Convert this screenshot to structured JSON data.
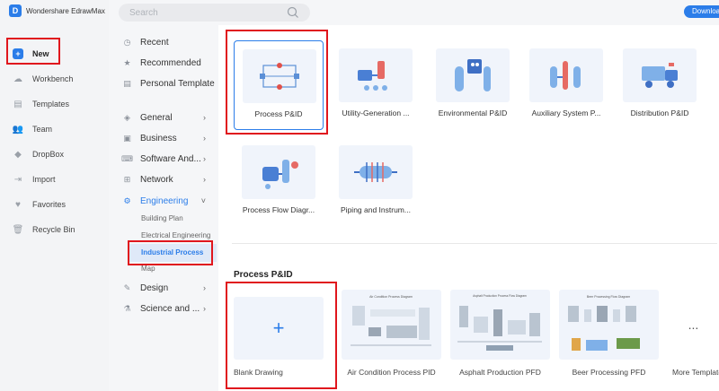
{
  "app": {
    "title": "Wondershare EdrawMax"
  },
  "nav": {
    "items": [
      {
        "label": "New",
        "icon": "plus-icon"
      },
      {
        "label": "Workbench",
        "icon": "cloud-icon"
      },
      {
        "label": "Templates",
        "icon": "templates-icon"
      },
      {
        "label": "Team",
        "icon": "team-icon"
      },
      {
        "label": "DropBox",
        "icon": "dropbox-icon"
      },
      {
        "label": "Import",
        "icon": "import-icon"
      },
      {
        "label": "Favorites",
        "icon": "heart-icon"
      },
      {
        "label": "Recycle Bin",
        "icon": "trash-icon"
      }
    ]
  },
  "search": {
    "placeholder": "Search"
  },
  "download": {
    "label": "Download"
  },
  "categories": {
    "items": [
      {
        "label": "Recent"
      },
      {
        "label": "Recommended"
      },
      {
        "label": "Personal Template"
      },
      {
        "label": "General"
      },
      {
        "label": "Business"
      },
      {
        "label": "Software And..."
      },
      {
        "label": "Network"
      },
      {
        "label": "Engineering"
      },
      {
        "label": "Design"
      },
      {
        "label": "Science and ..."
      }
    ],
    "engineering_sub": [
      {
        "label": "Building Plan"
      },
      {
        "label": "Electrical Engineering"
      },
      {
        "label": "Industrial Process"
      },
      {
        "label": "Map"
      }
    ]
  },
  "templates": [
    {
      "label": "Process P&ID"
    },
    {
      "label": "Utility-Generation ..."
    },
    {
      "label": "Environmental P&ID"
    },
    {
      "label": "Auxiliary System P..."
    },
    {
      "label": "Distribution P&ID"
    },
    {
      "label": "Process Flow Diagr..."
    },
    {
      "label": "Piping and Instrum..."
    }
  ],
  "section": {
    "title": "Process P&ID",
    "blank": {
      "label": "Blank Drawing",
      "plus": "+"
    },
    "docs": [
      {
        "label": "Air Condition Process PID",
        "thumb_title": "Air Condition Process Diagram"
      },
      {
        "label": "Asphalt Production PFD",
        "thumb_title": "Asphalt Production Process Flow Diagram"
      },
      {
        "label": "Beer Processing PFD",
        "thumb_title": "Beer Processing Flow Diagram"
      },
      {
        "label": "More Templates",
        "ellipsis": "..."
      }
    ]
  },
  "colors": {
    "accent": "#2b7de9",
    "highlight": "#e0161d"
  }
}
